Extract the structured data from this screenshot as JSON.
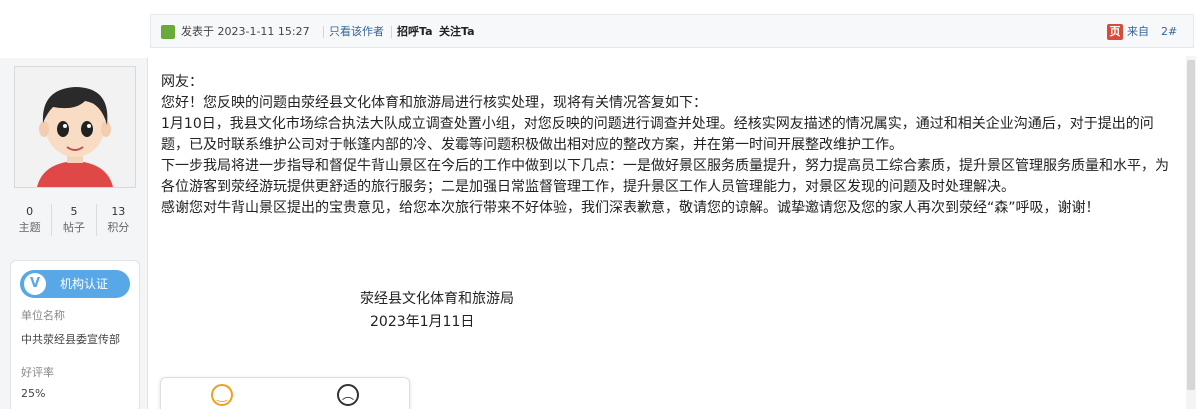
{
  "author": {
    "stats": [
      {
        "value": "0",
        "label": "主题"
      },
      {
        "value": "5",
        "label": "帖子"
      },
      {
        "value": "13",
        "label": "积分"
      }
    ],
    "cert_label": "机构认证",
    "org_name_label": "单位名称",
    "org_name": "中共荥经县委宣传部",
    "rating_label": "好评率",
    "rating": "25%"
  },
  "post_header": {
    "posted_label": "发表于 2023-1-11 15:27",
    "only_author": "只看该作者",
    "greet": "招呼Ta",
    "follow": "关注Ta",
    "badge_char": "页",
    "from_label": "来自",
    "floor": "2#"
  },
  "post_body": {
    "paragraphs": [
      "网友：",
      "您好！您反映的问题由荥经县文化体育和旅游局进行核实处理，现将有关情况答复如下：",
      "1月10日，我县文化市场综合执法大队成立调查处置小组，对您反映的问题进行调查并处理。经核实网友描述的情况属实，通过和相关企业沟通后，对于提出的问题，已及时联系维护公司对于帐篷内部的冷、发霉等问题积极做出相对应的整改方案，并在第一时间开展整改维护工作。",
      "下一步我局将进一步指导和督促牛背山景区在今后的工作中做到以下几点：一是做好景区服务质量提升，努力提高员工综合素质，提升景区管理服务质量和水平，为各位游客到荥经游玩提供更舒适的旅行服务；二是加强日常监督管理工作，提升景区工作人员管理能力，对景区发现的问题及时处理解决。",
      "感谢您对牛背山景区提出的宝贵意见，给您本次旅行带来不好体验，我们深表歉意，敬请您的谅解。诚挚邀请您及您的家人再次到荥经“森”呼吸，谢谢！"
    ],
    "signature_org": "荥经县文化体育和旅游局",
    "signature_date": "2023年1月11日"
  },
  "reactions": {
    "happy_icon": "smile-icon",
    "sad_icon": "frown-icon"
  }
}
